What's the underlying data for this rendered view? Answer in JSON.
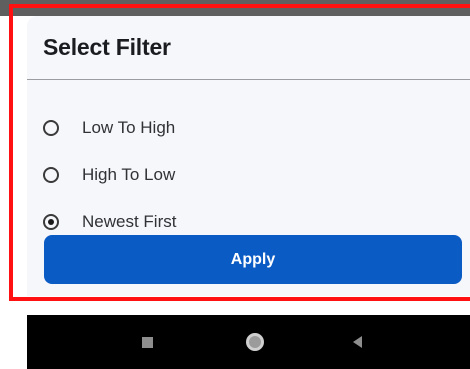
{
  "dialog": {
    "title": "Select Filter",
    "options": [
      {
        "label": "Low To High",
        "selected": false
      },
      {
        "label": "High To Low",
        "selected": false
      },
      {
        "label": "Newest First",
        "selected": true
      }
    ],
    "apply_label": "Apply"
  },
  "navbar": {
    "icons": [
      "recents-square-icon",
      "home-circle-icon",
      "back-triangle-icon"
    ]
  },
  "colors": {
    "highlight": "#ff1111",
    "apply_button": "#0b5bc4",
    "sheet_background": "#f6f7fb",
    "navbar": "#000000"
  }
}
